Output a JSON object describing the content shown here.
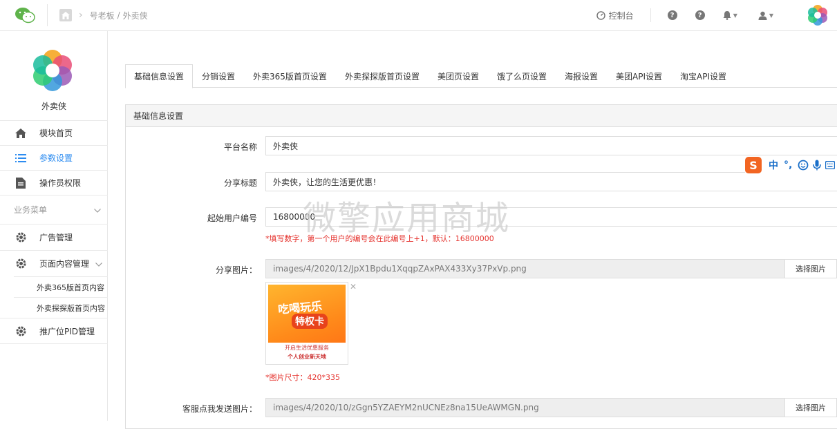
{
  "topbar": {
    "breadcrumb": [
      "号老板",
      "外卖侠"
    ],
    "console_label": "控制台"
  },
  "sidebar": {
    "brand_name": "外卖侠",
    "items": [
      {
        "label": "模块首页",
        "icon": "home-icon"
      },
      {
        "label": "参数设置",
        "icon": "list-icon",
        "active": true
      },
      {
        "label": "操作员权限",
        "icon": "document-icon"
      }
    ],
    "group_label": "业务菜单",
    "group_items": [
      {
        "label": "广告管理",
        "icon": "gear-icon"
      },
      {
        "label": "页面内容管理",
        "icon": "gear-icon"
      }
    ],
    "sub_items": [
      "外卖365版首页内容",
      "外卖探探版首页内容"
    ],
    "last_item": {
      "label": "推广位PID管理",
      "icon": "gear-icon"
    }
  },
  "tabs": [
    "基础信息设置",
    "分销设置",
    "外卖365版首页设置",
    "外卖探探版首页设置",
    "美团页设置",
    "饿了么页设置",
    "海报设置",
    "美团API设置",
    "淘宝API设置"
  ],
  "panel": {
    "title": "基础信息设置",
    "platform_name_label": "平台名称",
    "platform_name_value": "外卖侠",
    "share_title_label": "分享标题",
    "share_title_value": "外卖侠，让您的生活更优惠！",
    "start_id_label": "起始用户编号",
    "start_id_value": "16800000",
    "start_id_hint": "*填写数字，第一个用户的编号会在此编号上+1，默认：16800000",
    "share_image_label": "分享图片：",
    "share_image_value": "images/4/2020/12/JpX1Bpdu1XqqpZAxPAX433Xy37PxVp.png",
    "pick_label": "选择图片",
    "image_text_1": "吃喝玩乐",
    "image_text_2": "特权卡",
    "image_text_3": "开启生活优惠服务",
    "image_text_4": "个人创业新天地",
    "image_size_hint": "*图片尺寸：420*335",
    "cs_image_label": "客服点我发送图片：",
    "cs_image_value": "images/4/2020/10/zGgn5YZAEYM2nUCNEz8na15UeAWMGN.png",
    "cs_pick_label": "选择图片"
  },
  "watermark": "微擎应用商城",
  "ime": {
    "logo": "S",
    "mode": "中"
  }
}
